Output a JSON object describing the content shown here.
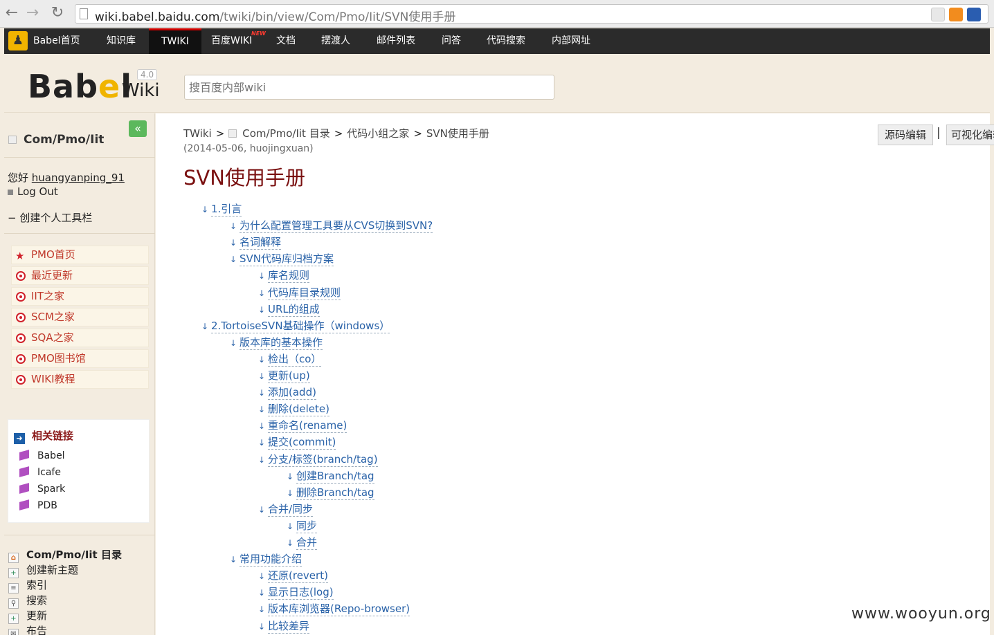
{
  "browser": {
    "url_host": "wiki.babel.baidu.com",
    "url_path": "/twiki/bin/view/Com/Pmo/Iit/SVN使用手册"
  },
  "topnav": {
    "brand": "Babel首页",
    "items": [
      "知识库",
      "TWIKI",
      "百度WIKI",
      "文档",
      "摆渡人",
      "邮件列表",
      "问答",
      "代码搜索",
      "内部网址"
    ],
    "active": "TWIKI",
    "new_badge": "NEW"
  },
  "header": {
    "logo_text": "Babel",
    "logo_wiki": "Wiki",
    "version": "4.0",
    "search_placeholder": "搜百度内部wiki"
  },
  "sidebar": {
    "web_title": "Com/Pmo/Iit",
    "greeting": "您好",
    "username": "huangyanping_91",
    "logout": "Log Out",
    "personal_toolbar": "− 创建个人工具栏",
    "pmo_links": [
      "PMO首页",
      "最近更新",
      "IIT之家",
      "SCM之家",
      "SQA之家",
      "PMO图书馆",
      "WIKI教程"
    ],
    "related_title": "相关链接",
    "related_links": [
      "Babel",
      "Icafe",
      "Spark",
      "PDB"
    ],
    "tools": [
      "Com/Pmo/Iit 目录",
      "创建新主题",
      "索引",
      "搜索",
      "更新",
      "布告"
    ]
  },
  "main": {
    "breadcrumb": [
      "TWiki",
      "Com/Pmo/Iit 目录",
      "代码小组之家",
      "SVN使用手册"
    ],
    "revinfo": "(2014-05-06, huojingxuan)",
    "edit_button": "源码编辑",
    "edit_separator": "|",
    "visual_button": "可视化编辑",
    "title": "SVN使用手册",
    "toc": [
      {
        "level": 1,
        "text": "1.引言"
      },
      {
        "level": 2,
        "text": "为什么配置管理工具要从CVS切换到SVN?"
      },
      {
        "level": 2,
        "text": "名词解释"
      },
      {
        "level": 2,
        "text": "SVN代码库归档方案"
      },
      {
        "level": 3,
        "text": "库名规则"
      },
      {
        "level": 3,
        "text": "代码库目录规则"
      },
      {
        "level": 3,
        "text": "URL的组成"
      },
      {
        "level": 1,
        "text": "2.TortoiseSVN基础操作（windows）"
      },
      {
        "level": 2,
        "text": "版本库的基本操作"
      },
      {
        "level": 3,
        "text": "检出（co）"
      },
      {
        "level": 3,
        "text": "更新(up)"
      },
      {
        "level": 3,
        "text": "添加(add)"
      },
      {
        "level": 3,
        "text": "删除(delete)"
      },
      {
        "level": 3,
        "text": "重命名(rename)"
      },
      {
        "level": 3,
        "text": "提交(commit)"
      },
      {
        "level": 3,
        "text": "分支/标签(branch/tag)"
      },
      {
        "level": 4,
        "text": "创建Branch/tag"
      },
      {
        "level": 4,
        "text": "删除Branch/tag"
      },
      {
        "level": 3,
        "text": "合并/同步"
      },
      {
        "level": 4,
        "text": "同步"
      },
      {
        "level": 4,
        "text": "合并"
      },
      {
        "level": 2,
        "text": "常用功能介绍"
      },
      {
        "level": 3,
        "text": "还原(revert)"
      },
      {
        "level": 3,
        "text": "显示日志(log)"
      },
      {
        "level": 3,
        "text": "版本库浏览器(Repo-browser)"
      },
      {
        "level": 3,
        "text": "比较差异"
      }
    ]
  },
  "watermark": "www.wooyun.org"
}
